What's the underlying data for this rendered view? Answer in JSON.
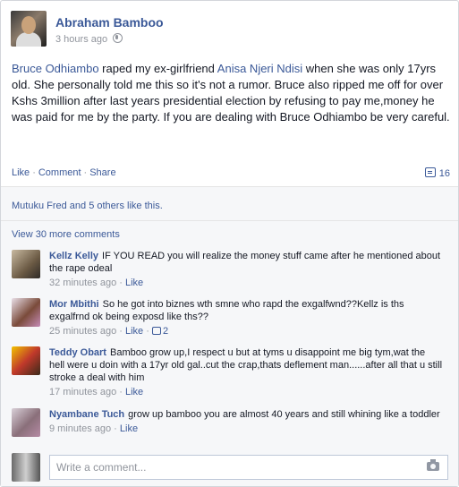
{
  "post": {
    "author": "Abraham Bamboo",
    "time": "3 hours ago",
    "text_parts": {
      "mention1": "Bruce Odhiambo",
      "t1": " raped my ex-girlfriend ",
      "mention2": "Anisa Njeri Ndisi",
      "t2": " when she was only 17yrs old. She personally told me this so it's not a rumor. Bruce also ripped me off for over Kshs 3million after last years presidential election by refusing to pay me,money he was paid for me by the party. If you are dealing with Bruce Odhiambo be very careful."
    }
  },
  "actions": {
    "like": "Like",
    "comment": "Comment",
    "share": "Share",
    "comment_count": "16"
  },
  "likes_summary": "Mutuku Fred and 5 others like this.",
  "view_more": "View 30 more comments",
  "comments": [
    {
      "name": "Kellz Kelly",
      "text": "IF YOU READ you will realize the money stuff came after he mentioned about the rape odeal",
      "time": "32 minutes ago",
      "like": "Like",
      "likes": ""
    },
    {
      "name": "Mor Mbithi",
      "text": "So he got into biznes wth smne who rapd the exgalfwnd??Kellz is ths exgalfrnd ok being exposd like ths??",
      "time": "25 minutes ago",
      "like": "Like",
      "likes": "2"
    },
    {
      "name": "Teddy Obart",
      "text": "Bamboo grow up,I respect u but at tyms u disappoint me big tym,wat the hell were u doin with a 17yr old gal..cut the crap,thats deflement man......after all that u still stroke a deal with him",
      "time": "17 minutes ago",
      "like": "Like",
      "likes": ""
    },
    {
      "name": "Nyambane Tuch",
      "text": "grow up bamboo you are almost 40 years and still whining like a toddler",
      "time": "9 minutes ago",
      "like": "Like",
      "likes": ""
    }
  ],
  "composer": {
    "placeholder": "Write a comment..."
  },
  "icons": {
    "privacy": "globe-icon",
    "comments": "comment-icon",
    "camera": "camera-icon",
    "like": "thumbs-up-icon"
  },
  "colors": {
    "link": "#3b5998",
    "meta": "#90949c",
    "ufi_bg": "#f6f7f9"
  }
}
